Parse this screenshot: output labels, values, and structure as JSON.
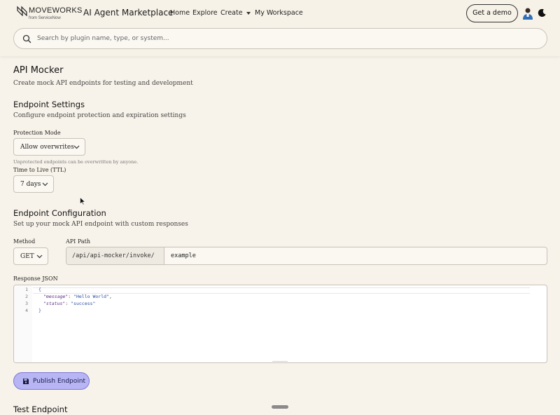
{
  "header": {
    "logo_text": "MOVEWORKS",
    "logo_sub": "from ServiceNow",
    "brand_title": "AI Agent Marketplace",
    "nav": {
      "home": "Home",
      "explore": "Explore",
      "create": "Create",
      "workspace": "My Workspace"
    },
    "demo_button": "Get a demo"
  },
  "search": {
    "placeholder": "Search by plugin name, type, or system..."
  },
  "page": {
    "title": "API Mocker",
    "subtitle": "Create mock API endpoints for testing and development"
  },
  "endpoint_settings": {
    "heading": "Endpoint Settings",
    "description": "Configure endpoint protection and expiration settings",
    "protection_label": "Protection Mode",
    "protection_value": "Allow overwrites",
    "protection_hint": "Unprotected endpoints can be overwritten by anyone.",
    "ttl_label": "Time to Live (TTL)",
    "ttl_value": "7 days"
  },
  "endpoint_configuration": {
    "heading": "Endpoint Configuration",
    "description": "Set up your mock API endpoint with custom responses",
    "method_label": "Method",
    "method_value": "GET",
    "path_label": "API Path",
    "path_prefix": "/api/api-mocker/invoke/",
    "path_value": "example"
  },
  "response": {
    "label": "Response JSON",
    "lines": [
      "1",
      "2",
      "3",
      "4"
    ],
    "open_brace": "{",
    "close_brace": "}",
    "key_message": "\"message\"",
    "val_message": "\"Hello World\"",
    "key_status": "\"status\"",
    "val_status": "\"success\""
  },
  "publish_button": "Publish Endpoint",
  "test_heading": "Test Endpoint",
  "colors": {
    "background": "#f8f3ea",
    "publish_button": "#b7b5f4",
    "json_key": "#5a2a86",
    "json_string": "#2a4fa0"
  }
}
